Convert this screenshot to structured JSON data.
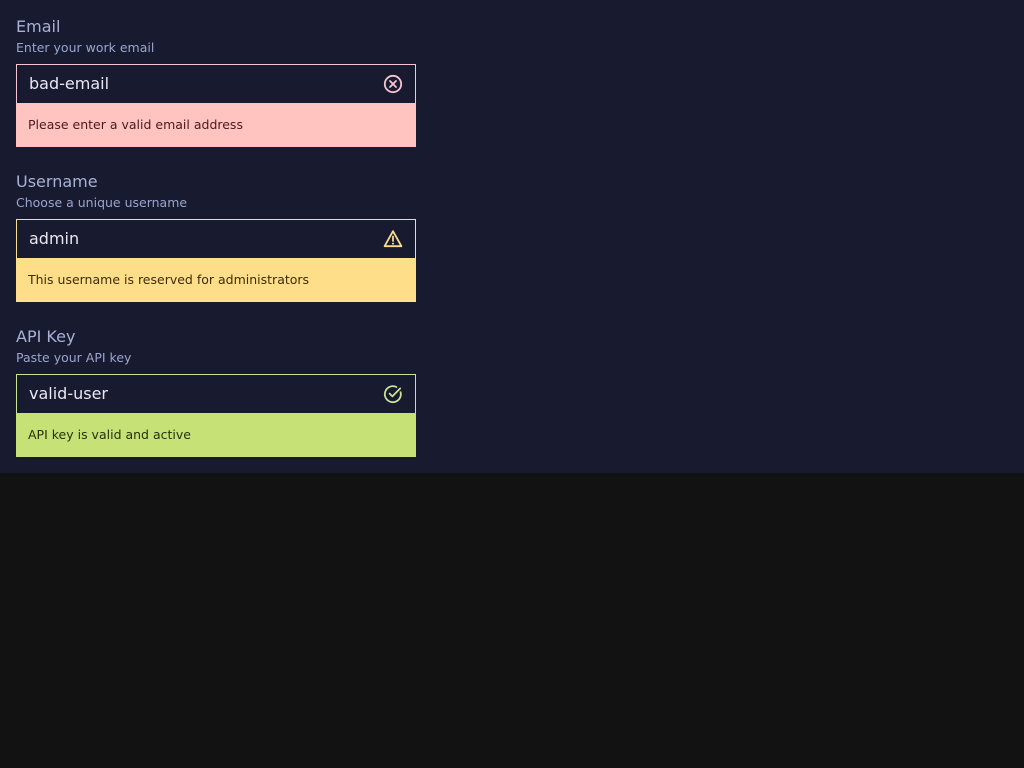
{
  "fields": [
    {
      "label": "Email",
      "hint": "Enter your work email",
      "value": "bad-email",
      "status": "error",
      "icon": "error-circle-icon",
      "message": "Please enter a valid email address"
    },
    {
      "label": "Username",
      "hint": "Choose a unique username",
      "value": "admin",
      "status": "warning",
      "icon": "warning-triangle-icon",
      "message": "This username is reserved for administrators"
    },
    {
      "label": "API Key",
      "hint": "Paste your API key",
      "value": "valid-user",
      "status": "success",
      "icon": "check-circle-icon",
      "message": "API key is valid and active"
    }
  ],
  "colors": {
    "panel_bg": "#181a2f",
    "page_bg": "#121212",
    "error_bg": "#ffc3c0",
    "warning_bg": "#ffde89",
    "success_bg": "#c6e277"
  }
}
